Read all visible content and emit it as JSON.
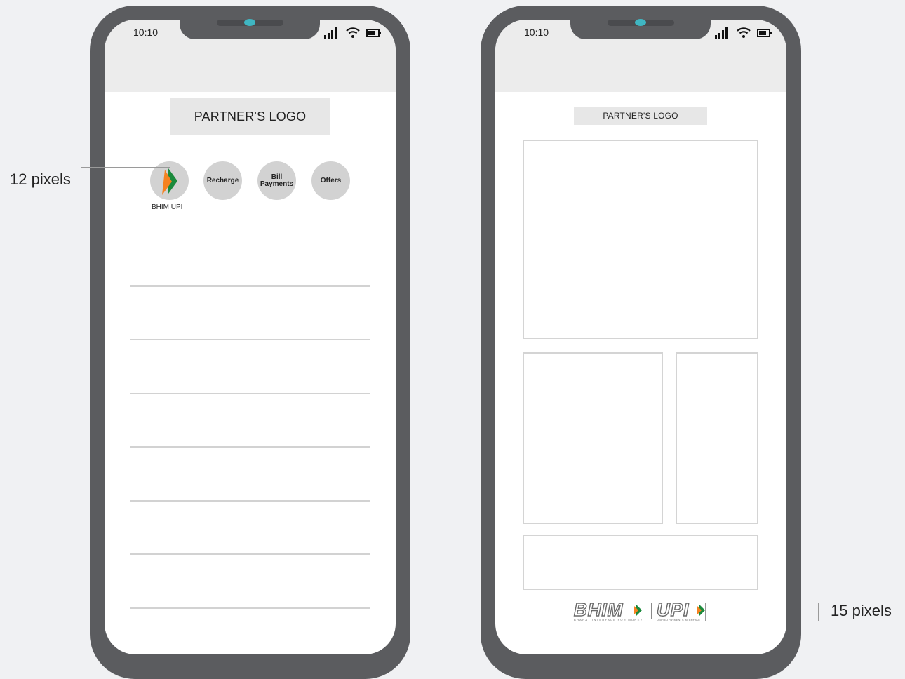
{
  "left_phone": {
    "time": "10:10",
    "partner_logo": "PARTNER'S LOGO",
    "quick_actions": [
      {
        "label": ""
      },
      {
        "label": "Recharge"
      },
      {
        "label": "Bill\nPayments"
      },
      {
        "label": "Offers"
      }
    ],
    "upi_caption": "BHIM UPI",
    "divider_count": 7
  },
  "right_phone": {
    "time": "10:10",
    "partner_logo": "PARTNER'S LOGO",
    "brand": {
      "bhim": "BHIM",
      "bhim_tagline": "BHARAT INTERFACE FOR MONEY",
      "upi": "UPI",
      "upi_tagline": "UNIFIED PAYMENTS INTERFACE"
    }
  },
  "annotations": {
    "left": "12 pixels",
    "right": "15 pixels"
  },
  "colors": {
    "phone_frame": "#5b5c5f",
    "camera": "#3fb6c2",
    "upi_orange": "#f58220",
    "upi_green": "#1b8a3c"
  }
}
